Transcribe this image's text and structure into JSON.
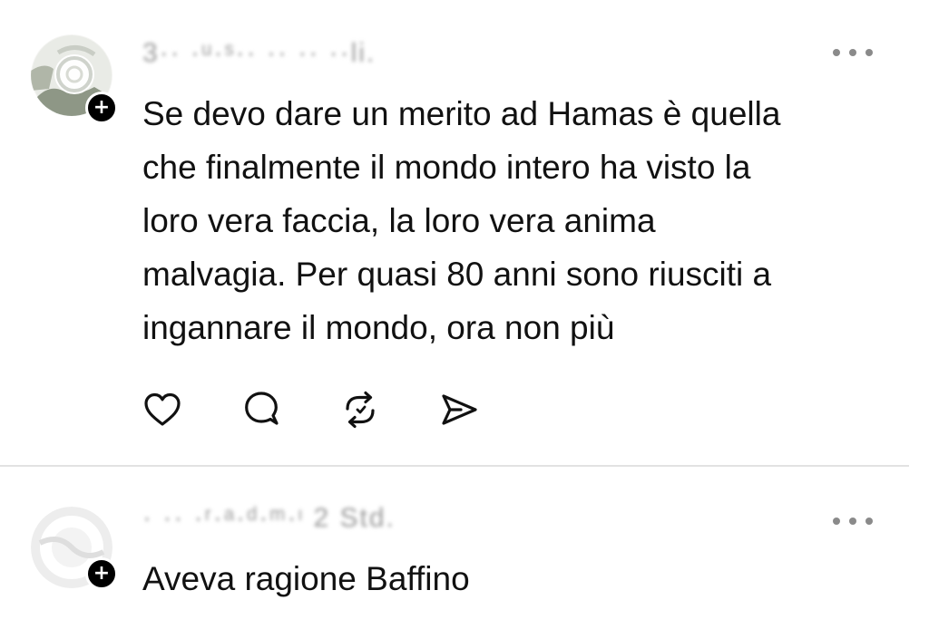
{
  "posts": [
    {
      "username": "3·· ·ᵘ·ˢ·· ·· ·· ··li.",
      "text": "Se devo dare un merito ad Hamas è quella\nche finalmente il mondo intero ha visto la\nloro vera faccia, la loro vera anima\nmalvagia. Per quasi 80 anni sono riusciti a\ningannare il mondo, ora non più",
      "follow_badge": "+",
      "actions": [
        "heart-icon",
        "comment-icon",
        "repost-icon",
        "share-icon"
      ]
    },
    {
      "username": "·  ·· ·ʳ·ᵃ·ᵈ·ᵐ·ᶦ 2 Std.",
      "text": "Aveva ragione Baffino",
      "follow_badge": "+"
    }
  ],
  "colors": {
    "text": "#111111",
    "muted": "#9a9a9a",
    "icon": "#111111",
    "divider": "#e2e2e2"
  }
}
